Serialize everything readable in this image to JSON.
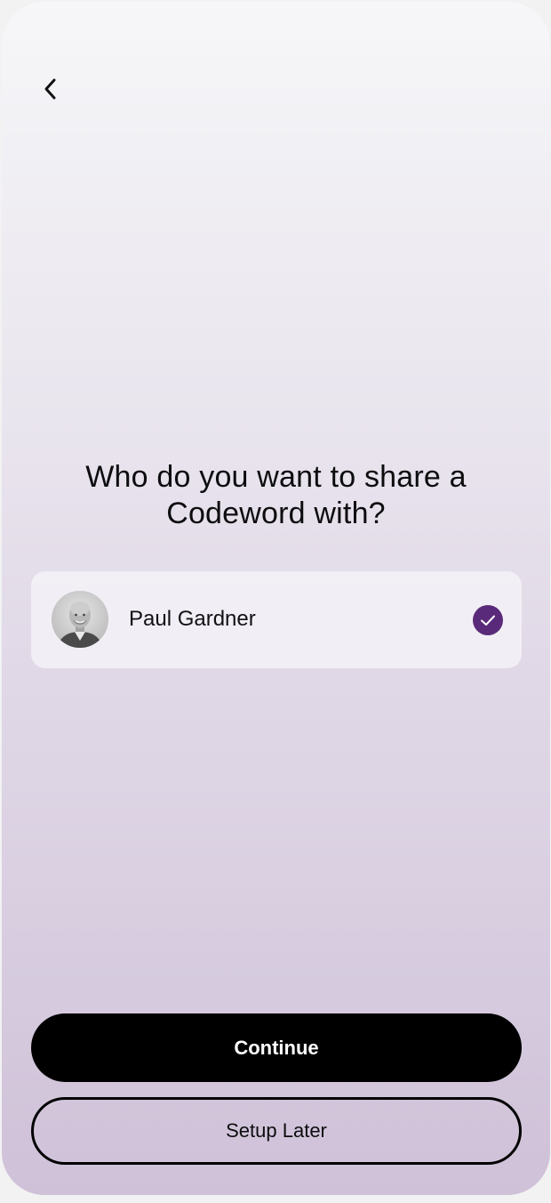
{
  "header": {
    "back_icon": "chevron-left-icon"
  },
  "main": {
    "title": "Who do you want to share a Codeword with?"
  },
  "contacts": [
    {
      "name": "Paul Gardner",
      "avatar_icon": "person-photo",
      "selected": true,
      "check_icon": "checkmark-icon"
    }
  ],
  "actions": {
    "continue_label": "Continue",
    "later_label": "Setup Later"
  },
  "colors": {
    "accent": "#5a2a7a",
    "primary_button": "#000000",
    "background_top": "#f7f7f9",
    "background_bottom": "#cfc1d8"
  }
}
